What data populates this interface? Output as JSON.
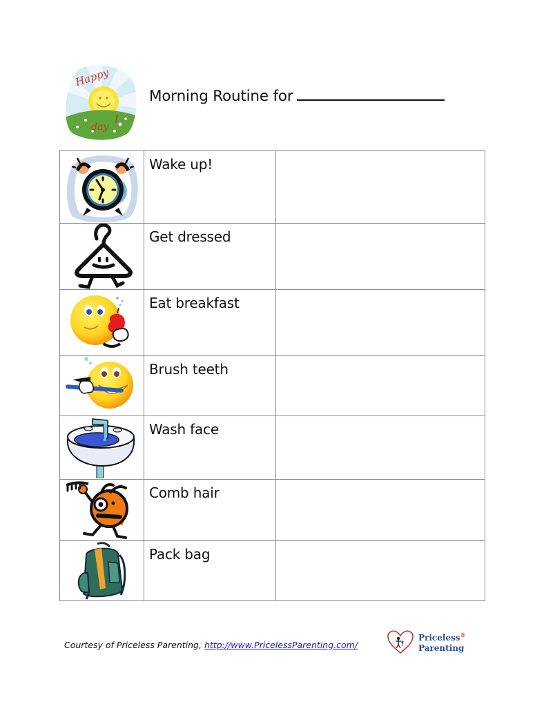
{
  "header": {
    "title": "Morning Routine for",
    "name_blank": "",
    "logo_icon": "happy-day-sun-icon"
  },
  "routine": {
    "rows": [
      {
        "label": "Wake up!",
        "icon": "alarm-clock-icon",
        "done": ""
      },
      {
        "label": "Get dressed",
        "icon": "clothes-hanger-icon",
        "done": ""
      },
      {
        "label": "Eat breakfast",
        "icon": "smiley-eating-apple-icon",
        "done": ""
      },
      {
        "label": "Brush teeth",
        "icon": "smiley-toothbrush-icon",
        "done": ""
      },
      {
        "label": "Wash face",
        "icon": "sink-icon",
        "done": ""
      },
      {
        "label": "Comb hair",
        "icon": "comb-character-icon",
        "done": ""
      },
      {
        "label": "Pack bag",
        "icon": "backpack-icon",
        "done": ""
      }
    ]
  },
  "footer": {
    "courtesy": "Courtesy of Priceless Parenting, ",
    "link": "http://www.PricelessParenting.com/",
    "brand_line1": "Priceless",
    "brand_line2": "Parenting",
    "registered": "®",
    "brand_icon": "heart-family-icon"
  },
  "colors": {
    "link": "#1a1ad8",
    "brand_text": "#2e4a9a",
    "heart": "#c0392b",
    "grid": "#8a8a8a"
  }
}
